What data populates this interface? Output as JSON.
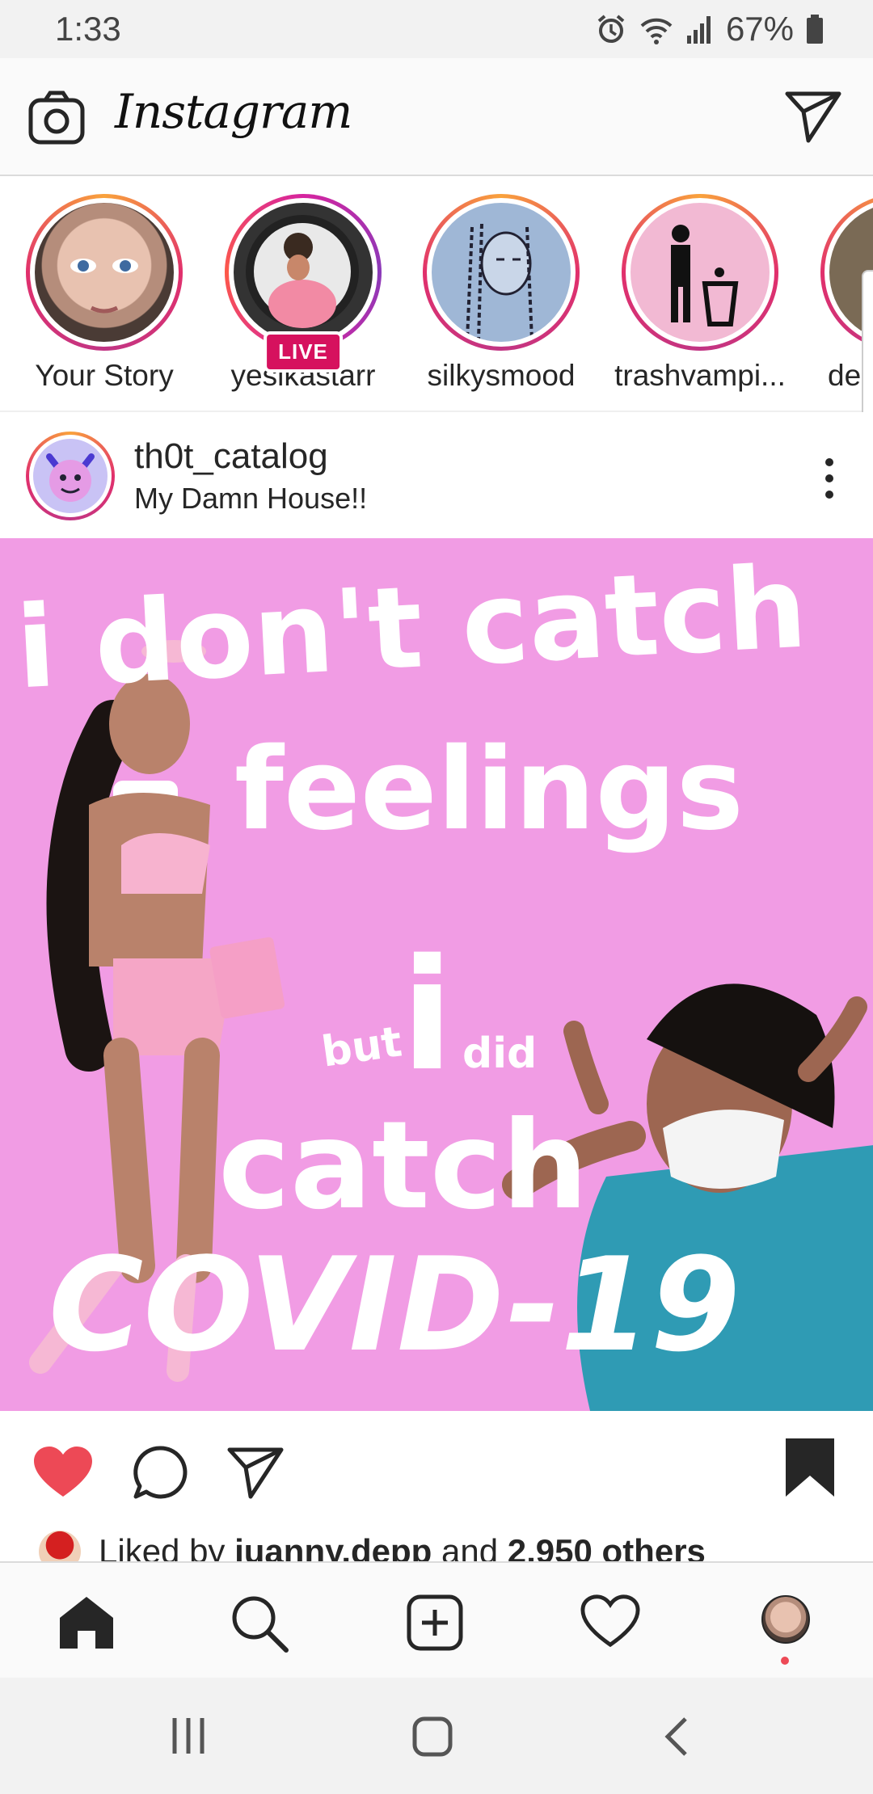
{
  "status_bar": {
    "time": "1:33",
    "battery": "67%",
    "icons": [
      "alarm-icon",
      "wifi-icon",
      "signal-icon",
      "battery-icon"
    ]
  },
  "header": {
    "wordmark": "Instagram",
    "icons": [
      "camera-icon",
      "direct-message-icon"
    ]
  },
  "stories": [
    {
      "label": "Your Story",
      "live": false
    },
    {
      "label": "yesikastarr",
      "live": true,
      "badge": "LIVE"
    },
    {
      "label": "silkysmood",
      "live": false
    },
    {
      "label": "trashvampi...",
      "live": false
    },
    {
      "label": "de",
      "live": false
    }
  ],
  "post": {
    "username": "th0t_catalog",
    "location": "My Damn House!!",
    "image_text": {
      "line1": "i don't catch",
      "line2": "feelings",
      "small_left": "but",
      "big_i": "i",
      "small_right": "did",
      "line4": "catch",
      "line5": "COVID-19"
    },
    "liked": true,
    "saved": true,
    "likes": {
      "prefix": "Liked by",
      "user": "juanny.depp",
      "middle": "and",
      "others": "2,950 others"
    }
  },
  "bottom_nav": [
    "home-icon",
    "search-icon",
    "new-post-icon",
    "activity-icon",
    "profile-avatar"
  ],
  "system_nav": [
    "recent-apps-icon",
    "home-button-icon",
    "back-icon"
  ],
  "colors": {
    "like_red": "#ed4956",
    "post_bg": "#f19ce4",
    "live_badge": "#d6115e"
  }
}
